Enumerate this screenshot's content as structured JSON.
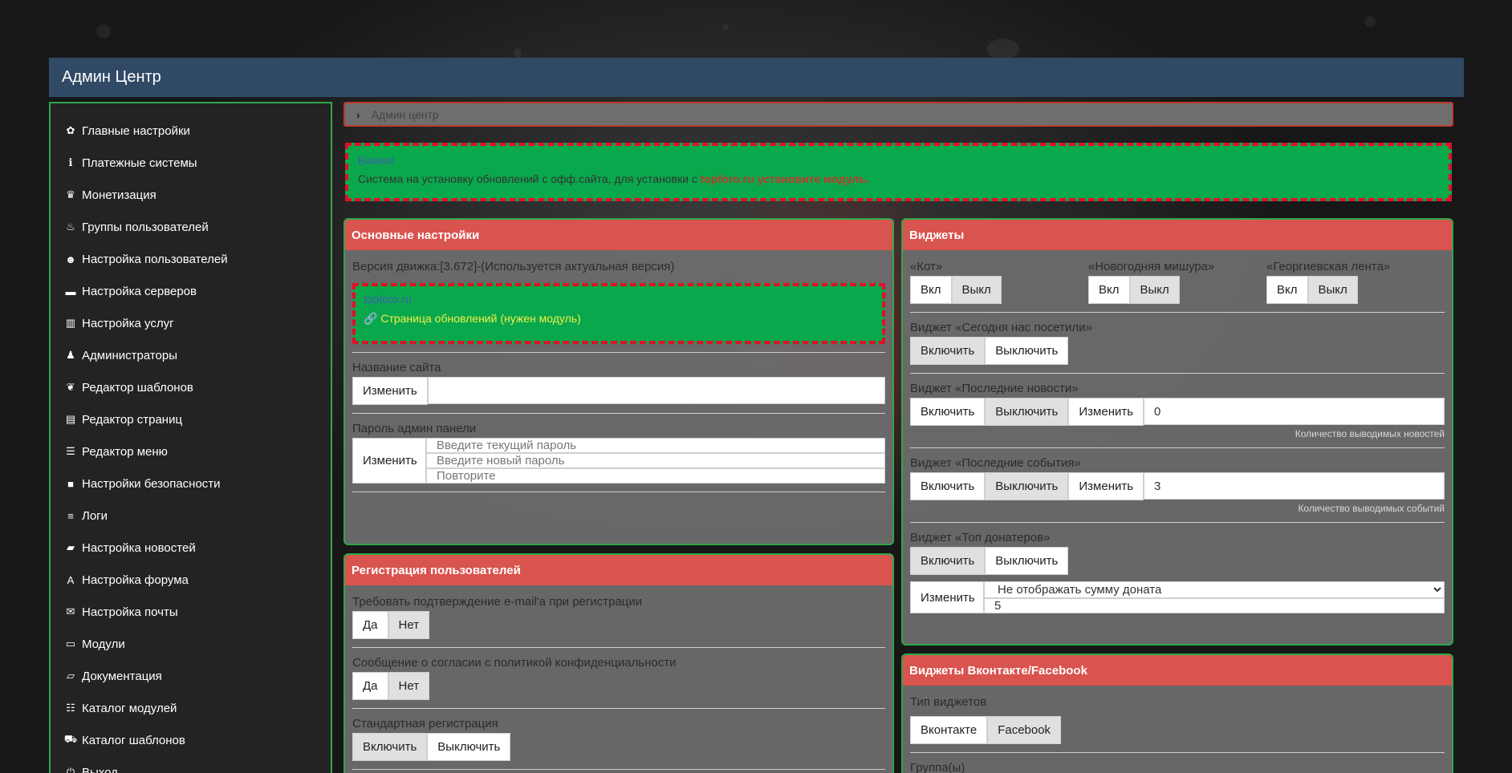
{
  "header": {
    "title": "Админ Центр"
  },
  "sidebar": {
    "items": [
      {
        "label": "Главные настройки",
        "icon": "✿",
        "name": "gear"
      },
      {
        "label": "Платежные системы",
        "icon": "ℹ",
        "name": "info"
      },
      {
        "label": "Монетизация",
        "icon": "♛",
        "name": "piggy-bank"
      },
      {
        "label": "Группы пользователей",
        "icon": "♨",
        "name": "fire"
      },
      {
        "label": "Настройка пользователей",
        "icon": "☻",
        "name": "user"
      },
      {
        "label": "Настройка серверов",
        "icon": "▬",
        "name": "server"
      },
      {
        "label": "Настройка услуг",
        "icon": "▥",
        "name": "barcode"
      },
      {
        "label": "Администраторы",
        "icon": "♟",
        "name": "admins"
      },
      {
        "label": "Редактор шаблонов",
        "icon": "❦",
        "name": "leaf"
      },
      {
        "label": "Редактор страниц",
        "icon": "▤",
        "name": "file"
      },
      {
        "label": "Редактор меню",
        "icon": "☰",
        "name": "list"
      },
      {
        "label": "Настройки безопасности",
        "icon": "■",
        "name": "lock"
      },
      {
        "label": "Логи",
        "icon": "≡",
        "name": "logs"
      },
      {
        "label": "Настройка новостей",
        "icon": "▰",
        "name": "briefcase"
      },
      {
        "label": "Настройка форума",
        "icon": "A",
        "name": "font"
      },
      {
        "label": "Настройка почты",
        "icon": "✉",
        "name": "envelope"
      },
      {
        "label": "Модули",
        "icon": "▭",
        "name": "hdd"
      },
      {
        "label": "Документация",
        "icon": "▱",
        "name": "folder-open"
      },
      {
        "label": "Каталог модулей",
        "icon": "☷",
        "name": "catalog"
      },
      {
        "label": "Каталог шаблонов",
        "icon": "⛟",
        "name": "cart"
      },
      {
        "label": "Выход",
        "icon": "⏻",
        "name": "power"
      }
    ]
  },
  "breadcrumb": {
    "label": "Админ центр"
  },
  "notice": {
    "title": "Важно!",
    "text": "Система на установку обновлений с офф.сайта, для установки с ",
    "link": "topforo.ru установите модуль."
  },
  "main_settings": {
    "title": "Основные настройки",
    "engine_version": "Версия движка:[3.672]-(Используется актуальная версия)",
    "update_box": {
      "site": "topforo.ru",
      "updates_link": "Страница обновлений (нужен модуль)"
    },
    "site_name_label": "Название сайта",
    "change_label": "Изменить",
    "site_name_value": "",
    "password_label": "Пароль админ панели",
    "pw_current_placeholder": "Введите текущий пароль",
    "pw_new_placeholder": "Введите новый пароль",
    "pw_repeat_placeholder": "Повторите"
  },
  "registration": {
    "title": "Регистрация пользователей",
    "email_confirm_label": "Требовать подтверждение e-mail'a при регистрации",
    "privacy_label": "Сообщение о согласии с политикой конфиденциальности",
    "standard_reg_label": "Стандартная регистрация",
    "yes": "Да",
    "no": "Нет",
    "enable": "Включить",
    "disable": "Выключить"
  },
  "widgets": {
    "title": "Виджеты",
    "on": "Вкл",
    "off": "Выкл",
    "enable": "Включить",
    "disable": "Выключить",
    "change": "Изменить",
    "cat_label": "«Кот»",
    "tinsel_label": "«Новогодняя мишура»",
    "ribbon_label": "«Георгиевская лента»",
    "today_label": "Виджет «Сегодня нас посетили»",
    "news_label": "Виджет «Последние новости»",
    "news_count": "0",
    "news_hint": "Количество выводимых новостей",
    "events_label": "Виджет «Последние события»",
    "events_count": "3",
    "events_hint": "Количество выводимых событий",
    "donors_label": "Виджет «Топ донатеров»",
    "donors_select": "Не отображать сумму доната",
    "donors_count": "5"
  },
  "social": {
    "title": "Виджеты Вконтакте/Facebook",
    "type_label": "Тип виджетов",
    "vk": "Вконтакте",
    "fb": "Facebook",
    "groups_label": "Группа(ы)"
  }
}
